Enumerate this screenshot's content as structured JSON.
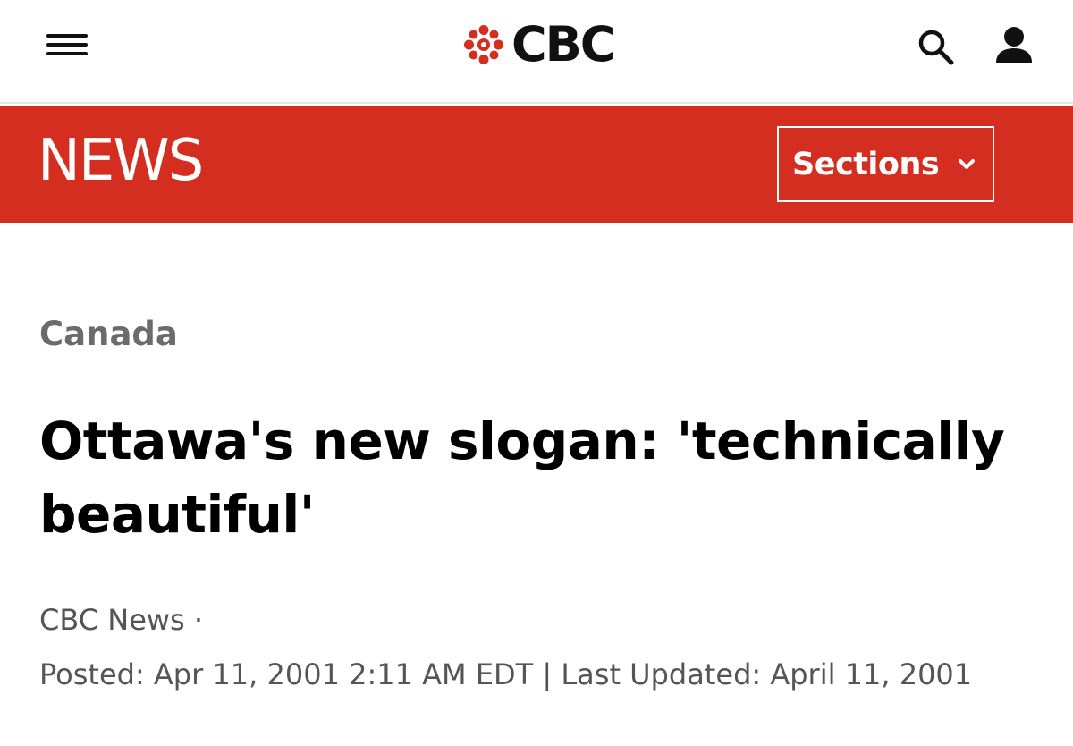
{
  "header": {
    "logo_text": "CBC",
    "menu_icon": "hamburger-menu-icon",
    "search_icon": "search-icon",
    "account_icon": "user-icon"
  },
  "news_bar": {
    "title": "NEWS",
    "sections_label": "Sections",
    "sections_icon": "chevron-down-icon",
    "background_color": "#d42e21"
  },
  "article": {
    "category": "Canada",
    "headline": "Ottawa's new slogan: 'technically beautiful'",
    "byline": "CBC News ·",
    "posted": "Posted: Apr 11, 2001 2:11 AM EDT | Last Updated: April 11, 2001"
  }
}
